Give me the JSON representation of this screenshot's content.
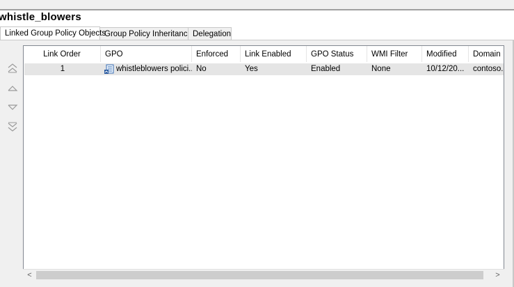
{
  "container_title": "whistle_blowers",
  "tabs": [
    {
      "label": "Linked Group Policy Objects",
      "active": true
    },
    {
      "label": "Group Policy Inheritance",
      "active": false
    },
    {
      "label": "Delegation",
      "active": false
    }
  ],
  "order_buttons": [
    "move-to-top-icon",
    "move-up-icon",
    "move-down-icon",
    "move-to-bottom-icon"
  ],
  "columns": [
    "Link Order",
    "GPO",
    "Enforced",
    "Link Enabled",
    "GPO Status",
    "WMI Filter",
    "Modified",
    "Domain"
  ],
  "sorted_column": "Link Order",
  "rows": [
    {
      "link_order": "1",
      "gpo": "whistleblowers polici...",
      "enforced": "No",
      "link_enabled": "Yes",
      "gpo_status": "Enabled",
      "wmi_filter": "None",
      "modified": "10/12/20...",
      "domain": "contoso..."
    }
  ],
  "scrollbar": {
    "left_arrow": "<",
    "right_arrow": ">"
  },
  "colors": {
    "selected_row": "#e5e5e5",
    "panel_bg": "#f0f0f0",
    "grid_border": "#828790"
  }
}
